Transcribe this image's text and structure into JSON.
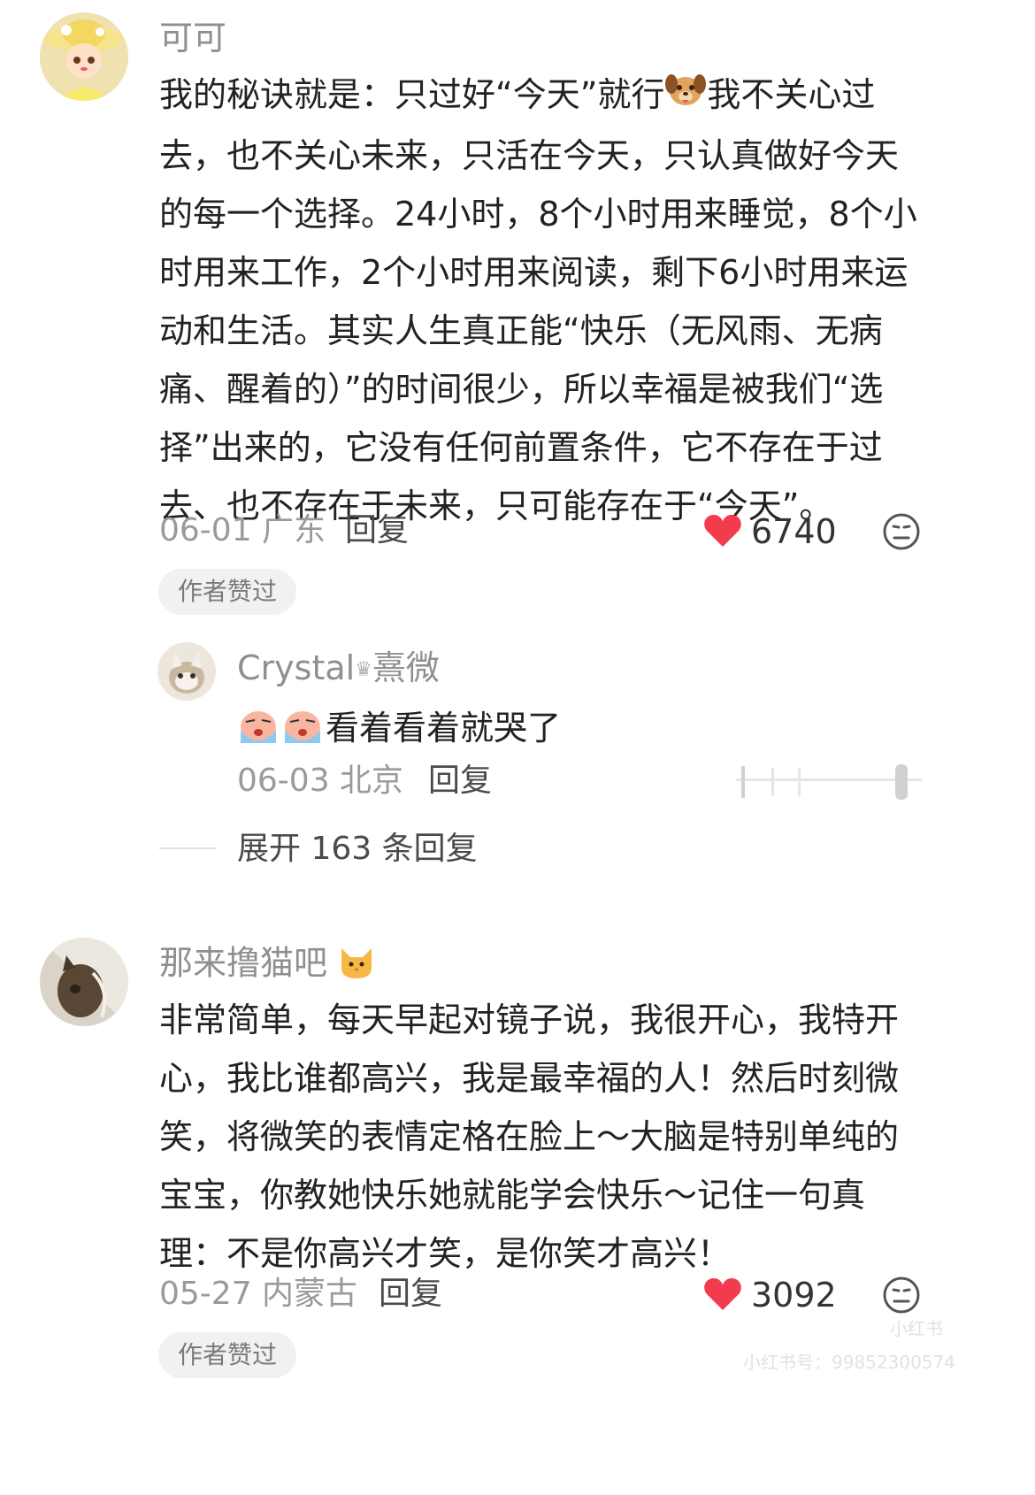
{
  "colors": {
    "accent_red": "#f23b4c",
    "username_gray": "#8f8f8f",
    "text": "#222222",
    "badge_bg": "#f1f1f1"
  },
  "comments": [
    {
      "username": "可可",
      "text_before_emoji": "我的秘诀就是：只过好“今天”就行",
      "emoji": "dog-face-emoji",
      "text_after_emoji": "我不关心过去，也不关心未来，只活在今天，只认真做好今天的每一个选择。24小时，8个小时用来睡觉，8个小时用来工作，2个小时用来阅读，剩下6小时用来运动和生活。其实人生真正能“快乐（无风雨、无病痛、醒着的）”的时间很少，所以幸福是被我们“选择”出来的，它没有任何前置条件，它不存在于过去、也不存在于未来，只可能存在于“今天”。",
      "date_location": "06-01 广东",
      "reply_label": "回复",
      "likes": "6740",
      "liked": true,
      "author_badge": "作者赞过",
      "icons": [
        "heart-icon",
        "neutral-face-icon"
      ],
      "replies": [
        {
          "username": "Crystal",
          "username_suffix": "熹微",
          "emoji": "crying-face-emoji",
          "text": "看着看着就哭了",
          "date_location": "06-03 北京",
          "reply_label": "回复"
        }
      ],
      "expand_label": "展开 163 条回复"
    },
    {
      "username": "那来撸猫吧",
      "name_emoji": "cat-face-emoji",
      "text": "非常简单，每天早起对镜子说，我很开心，我特开心，我比谁都高兴，我是最幸福的人！然后时刻微笑，将微笑的表情定格在脸上～大脑是特别单纯的宝宝，你教她快乐她就能学会快乐～记住一句真理：不是你高兴才笑，是你笑才高兴！",
      "date_location": "05-27 内蒙古",
      "reply_label": "回复",
      "likes": "3092",
      "liked": true,
      "author_badge": "作者赞过",
      "icons": [
        "heart-icon",
        "neutral-face-icon"
      ]
    }
  ],
  "watermark": {
    "brand": "小红书",
    "id_text": "小红书号：9985230057​4"
  }
}
